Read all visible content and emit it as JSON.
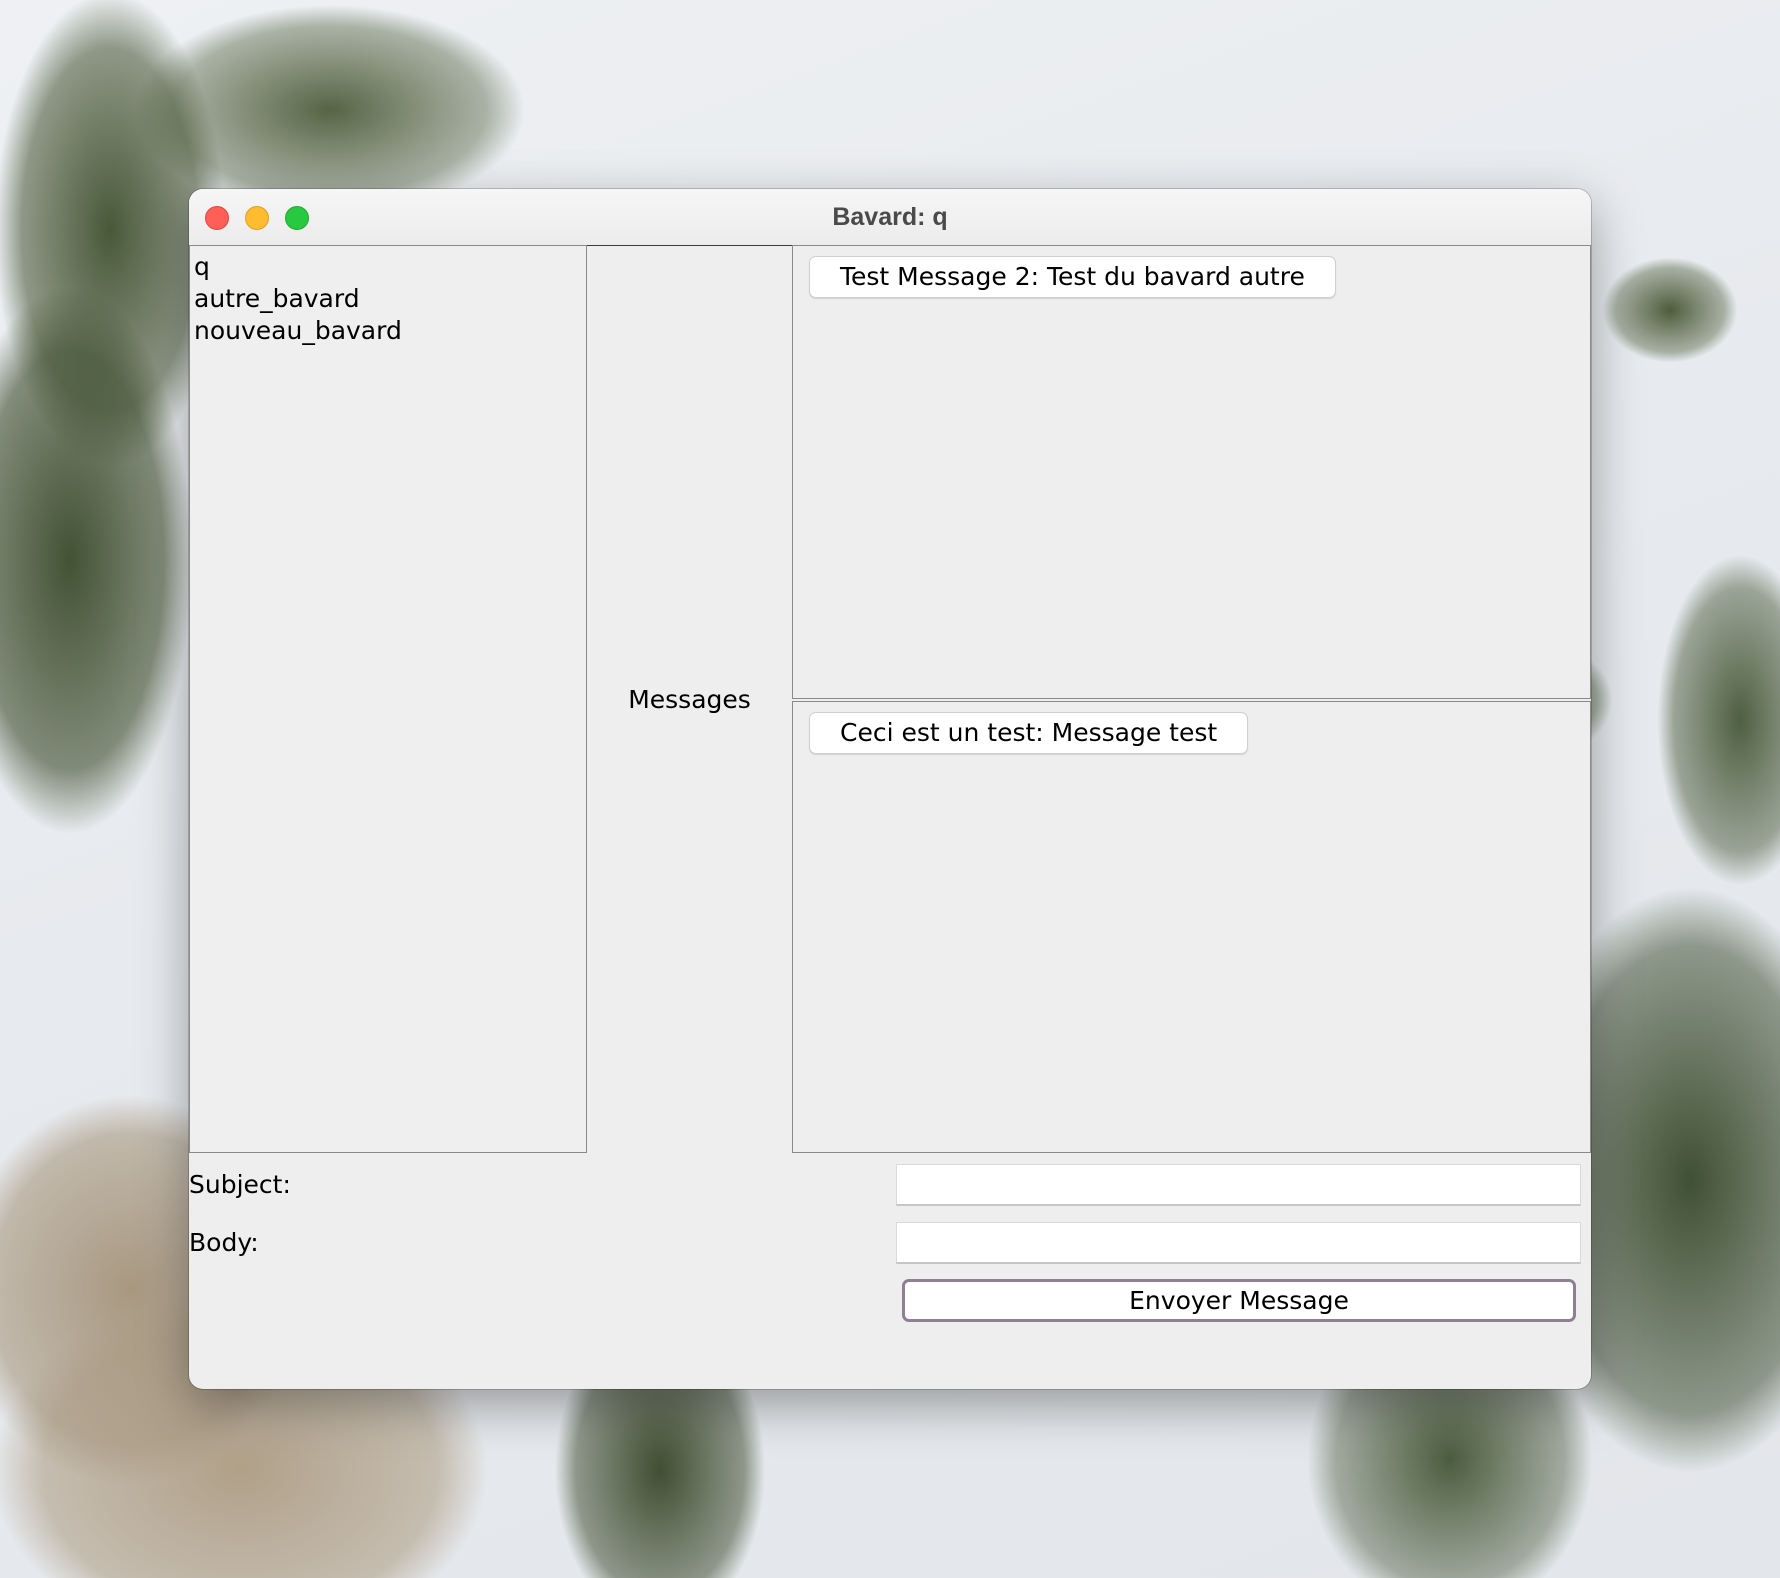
{
  "window": {
    "title": "Bavard: q"
  },
  "users": [
    "q",
    "autre_bavard",
    "nouveau_bavard"
  ],
  "messages_label": "Messages",
  "messages": [
    "Test Message 2: Test du bavard autre",
    "Ceci est un test: Message test"
  ],
  "form": {
    "subject_label": "Subject:",
    "subject_value": "",
    "body_label": "Body:",
    "body_value": "",
    "send_label": "Envoyer Message"
  },
  "colors": {
    "close": "#ff5f57",
    "minimize": "#febc2e",
    "maximize": "#28c840",
    "send_button_border": "#8e7f93"
  }
}
